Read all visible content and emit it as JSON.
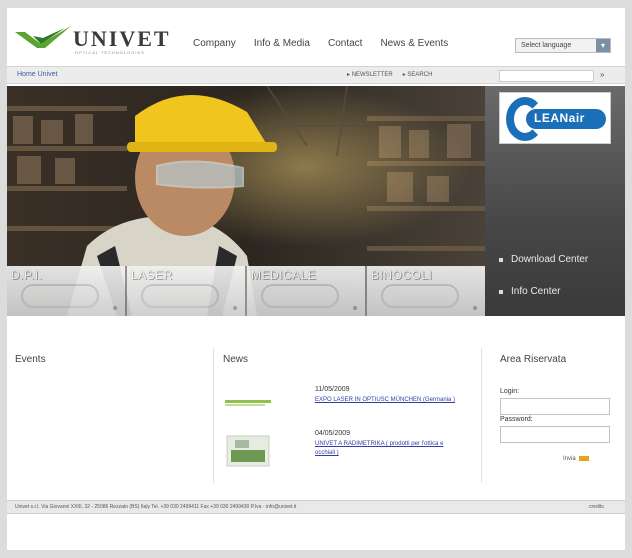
{
  "header": {
    "logo_name": "UNIVET",
    "logo_tagline": "OPTICAL TECHNOLOGIES",
    "nav": [
      {
        "label": "Company"
      },
      {
        "label": "Info & Media"
      },
      {
        "label": "Contact"
      },
      {
        "label": "News & Events"
      }
    ],
    "language_select": "Select language"
  },
  "subbar": {
    "home_link": "Home Univet",
    "links": [
      "NEWSLETTER",
      "SEARCH"
    ],
    "search_go": "»"
  },
  "hero": {
    "products": [
      {
        "label": "D.P.I."
      },
      {
        "label": "LASER"
      },
      {
        "label": "MEDICALE"
      },
      {
        "label": "BINOCOLI"
      }
    ],
    "side_logo_text": "LEANair",
    "side_links": [
      "Download Center",
      "Info Center"
    ]
  },
  "columns": {
    "events_title": "Events",
    "news_title": "News",
    "login_title": "Area Riservata"
  },
  "news": [
    {
      "date": "11/05/2009",
      "text": "EXPO LASER IN OPTIUSC MÜNCHEN (Germania )"
    },
    {
      "date": "04/05/2009",
      "text": "UNIVET A RADIMETRIKA ( prodotti per l'ottica e occhiali )"
    }
  ],
  "login": {
    "login_label": "Login:",
    "password_label": "Password:",
    "button_label": "Invia"
  },
  "footer": {
    "text": "Univet s.r.l. Via Giovanni XXIII, 32 - 25086 Rezzato (BS) Italy Tel. +39 030 2499411 Fax +39 030 2499430 P.Iva - info@univet.it",
    "credits": "credits"
  },
  "colors": {
    "brand_green": "#5aa532",
    "link_blue": "#2f3fa3",
    "leanair_blue": "#1b6fb8",
    "login_button": "#e7a21b"
  }
}
